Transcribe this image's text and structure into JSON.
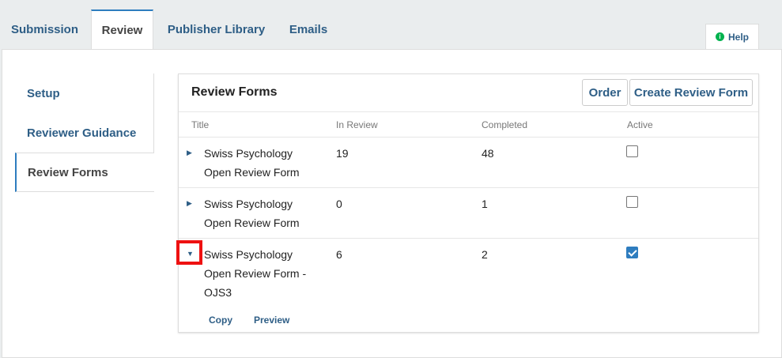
{
  "top_tabs": [
    "Submission",
    "Review",
    "Publisher Library",
    "Emails"
  ],
  "help": {
    "label": "Help",
    "icon": "info-icon"
  },
  "side_nav": [
    "Setup",
    "Reviewer Guidance",
    "Review Forms"
  ],
  "grid": {
    "title": "Review Forms",
    "buttons": {
      "order": "Order",
      "create": "Create Review Form"
    },
    "columns": [
      "Title",
      "In Review",
      "Completed",
      "Active"
    ],
    "rows": [
      {
        "title_line1": "Swiss Psychology",
        "title_line2": "Open Review Form",
        "title_line3": "",
        "in_review": "19",
        "completed": "48",
        "active": false,
        "expanded": false
      },
      {
        "title_line1": "Swiss Psychology",
        "title_line2": "Open Review Form",
        "title_line3": "",
        "in_review": "0",
        "completed": "1",
        "active": false,
        "expanded": false
      },
      {
        "title_line1": "Swiss Psychology",
        "title_line2": "Open Review Form -",
        "title_line3": "OJS3",
        "in_review": "6",
        "completed": "2",
        "active": true,
        "expanded": true
      }
    ],
    "row_actions": {
      "copy": "Copy",
      "preview": "Preview"
    }
  },
  "colors": {
    "link": "#2e5e86",
    "accent": "#2e7dbf",
    "highlight": "#ee1111",
    "help_icon": "#00b24e"
  }
}
